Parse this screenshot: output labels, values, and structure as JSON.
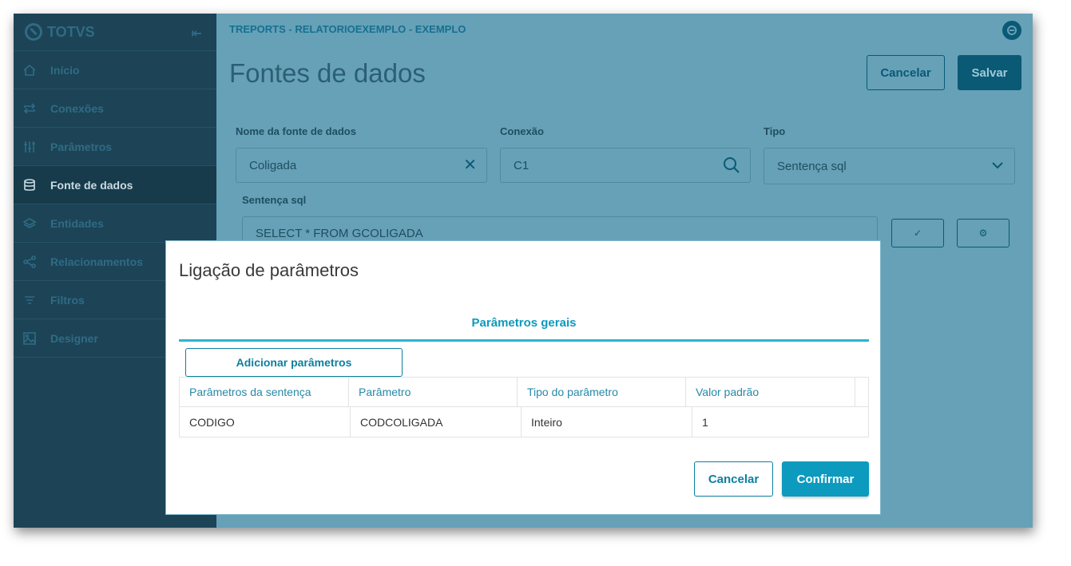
{
  "sidebar": {
    "logo": "TOTVS",
    "items": [
      {
        "label": "Início",
        "icon": "home-icon"
      },
      {
        "label": "Conexões",
        "icon": "sync-arrows-icon"
      },
      {
        "label": "Parâmetros",
        "icon": "sliders-icon"
      },
      {
        "label": "Fonte de dados",
        "icon": "database-icon",
        "active": true
      },
      {
        "label": "Entidades",
        "icon": "layers-icon"
      },
      {
        "label": "Relacionamentos",
        "icon": "share-nodes-icon"
      },
      {
        "label": "Filtros",
        "icon": "filter-icon"
      },
      {
        "label": "Designer",
        "icon": "image-icon"
      }
    ]
  },
  "header": {
    "breadcrumb": "TREPORTS - RELATORIOEXEMPLO - EXEMPLO",
    "title": "Fontes de dados",
    "cancel_label": "Cancelar",
    "save_label": "Salvar"
  },
  "form": {
    "name_label": "Nome da fonte de dados",
    "name_value": "Coligada",
    "connection_label": "Conexão",
    "connection_value": "C1",
    "type_label": "Tipo",
    "type_value": "Sentença sql",
    "sql_label": "Sentença sql",
    "sql_value": "SELECT * FROM GCOLIGADA"
  },
  "modal": {
    "title": "Ligação de parâmetros",
    "tab_label": "Parâmetros gerais",
    "add_label": "Adicionar parâmetros",
    "columns": [
      "Parâmetros da sentença",
      "Parâmetro",
      "Tipo do parâmetro",
      "Valor padrão"
    ],
    "rows": [
      [
        "CODIGO",
        "CODCOLIGADA",
        "Inteiro",
        "1"
      ]
    ],
    "cancel_label": "Cancelar",
    "confirm_label": "Confirmar"
  },
  "colors": {
    "sidebar": "#1c4456",
    "overlay": "#66a1b7",
    "primary": "#0c9abe",
    "tab_underline": "#29b6d0"
  }
}
